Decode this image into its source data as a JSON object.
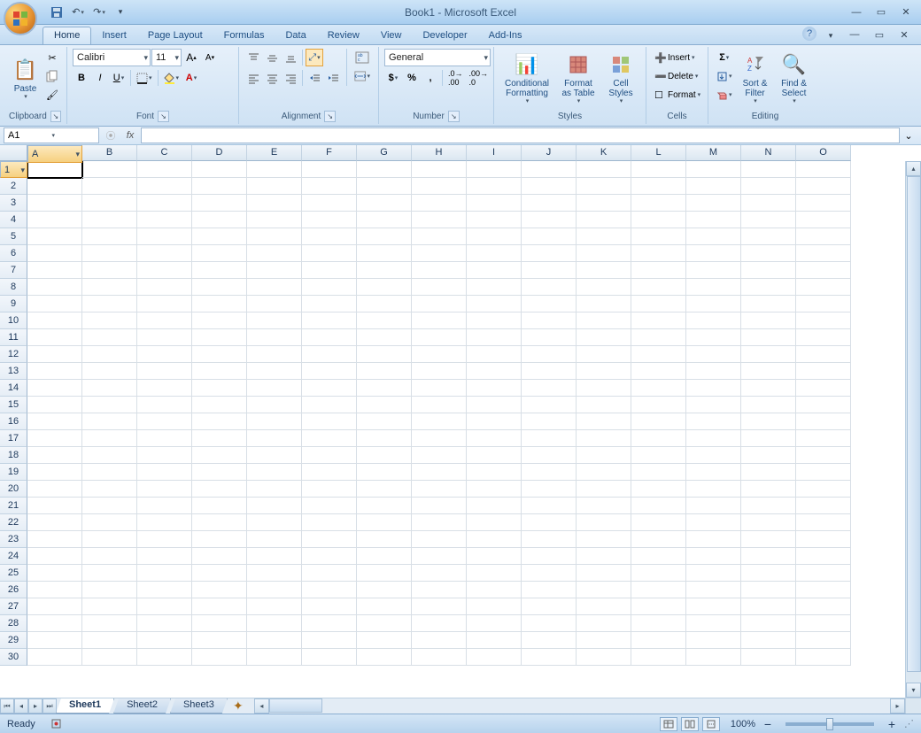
{
  "titlebar": {
    "title": "Book1 - Microsoft Excel",
    "qat": {
      "save": "save-icon",
      "undo": "undo-icon",
      "redo": "redo-icon"
    }
  },
  "tabs": [
    "Home",
    "Insert",
    "Page Layout",
    "Formulas",
    "Data",
    "Review",
    "View",
    "Developer",
    "Add-Ins"
  ],
  "active_tab": "Home",
  "ribbon": {
    "clipboard": {
      "label": "Clipboard",
      "paste": "Paste"
    },
    "font": {
      "label": "Font",
      "name": "Calibri",
      "size": "11"
    },
    "alignment": {
      "label": "Alignment"
    },
    "number": {
      "label": "Number",
      "format": "General",
      "currency": "$",
      "percent": "%",
      "comma": ",",
      "inc": ".0",
      "dec": ".00"
    },
    "styles": {
      "label": "Styles",
      "conditional": "Conditional Formatting",
      "formatastable": "Format as Table",
      "cellstyles": "Cell Styles"
    },
    "cells": {
      "label": "Cells",
      "insert": "Insert",
      "delete": "Delete",
      "format": "Format"
    },
    "editing": {
      "label": "Editing",
      "sortfilter": "Sort & Filter",
      "findselect": "Find & Select"
    }
  },
  "namebox": {
    "cell": "A1",
    "fx": "fx"
  },
  "columns": [
    "A",
    "B",
    "C",
    "D",
    "E",
    "F",
    "G",
    "H",
    "I",
    "J",
    "K",
    "L",
    "M",
    "N",
    "O"
  ],
  "rows": [
    1,
    2,
    3,
    4,
    5,
    6,
    7,
    8,
    9,
    10,
    11,
    12,
    13,
    14,
    15,
    16,
    17,
    18,
    19,
    20,
    21,
    22,
    23,
    24,
    25,
    26,
    27,
    28,
    29,
    30
  ],
  "active_cell": "A1",
  "sheets": [
    "Sheet1",
    "Sheet2",
    "Sheet3"
  ],
  "active_sheet": "Sheet1",
  "statusbar": {
    "status": "Ready",
    "zoom": "100%"
  }
}
